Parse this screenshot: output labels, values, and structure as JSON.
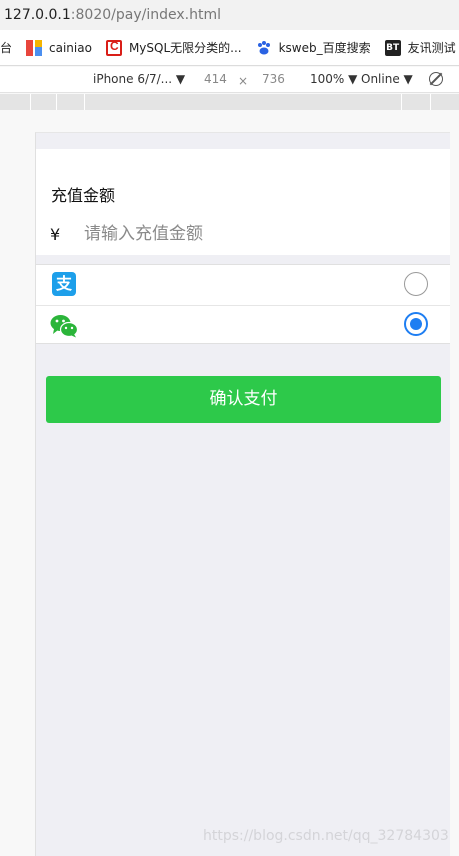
{
  "browser": {
    "url_host": "127.0.0.1",
    "url_path": ":8020/pay/index.html"
  },
  "bookmarks": {
    "partial": "台",
    "items": [
      {
        "label": "cainiao",
        "icon": "cainiao-icon"
      },
      {
        "label": "MySQL无限分类的...",
        "icon": "mysql-c-icon"
      },
      {
        "label": "ksweb_百度搜索",
        "icon": "baidu-paw-icon"
      },
      {
        "label": "友讯测试",
        "icon": "bt-icon"
      }
    ],
    "bt_icon_text": "BT"
  },
  "device_toolbar": {
    "device": "iPhone 6/7/... ▼",
    "width": "414",
    "times": "×",
    "height": "736",
    "zoom": "100% ▼",
    "network": "Online ▼"
  },
  "recharge": {
    "title": "充值金额",
    "currency_symbol": "¥",
    "amount_placeholder": "请输入充值金额",
    "amount_value": ""
  },
  "payment_methods": [
    {
      "name": "alipay",
      "icon": "alipay-icon",
      "icon_glyph": "支",
      "selected": false
    },
    {
      "name": "wechat-pay",
      "icon": "wechat-icon",
      "selected": true
    }
  ],
  "confirm_label": "确认支付",
  "colors": {
    "confirm_green": "#2dc94a",
    "radio_blue": "#1e7ef2",
    "alipay_blue": "#1d9fea",
    "wechat_green": "#2bb53a",
    "page_bg": "#efeff4"
  },
  "watermark": "https://blog.csdn.net/qq_32784303"
}
